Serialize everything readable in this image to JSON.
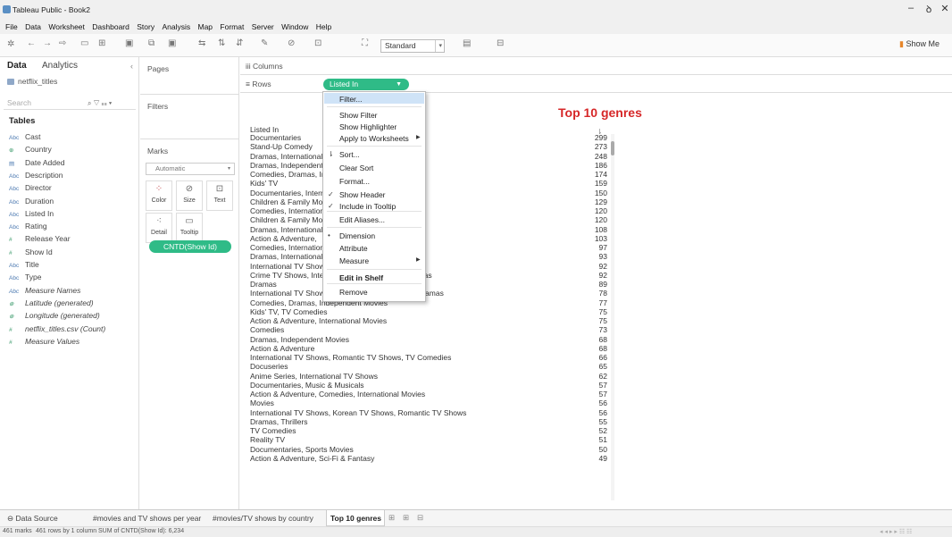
{
  "window": {
    "title": "Tableau Public - Book2",
    "controls": [
      "–",
      "ꝺ",
      "✕"
    ]
  },
  "menubar": [
    "File",
    "Data",
    "Worksheet",
    "Dashboard",
    "Story",
    "Analysis",
    "Map",
    "Format",
    "Server",
    "Window",
    "Help"
  ],
  "toolbar": {
    "fit_select": "Standard",
    "show_me": "Show Me"
  },
  "sidebar": {
    "tab_data": "Data",
    "tab_analytics": "Analytics",
    "datasource": "netflix_titles",
    "search_placeholder": "Search",
    "tables_header": "Tables",
    "fields": [
      {
        "icon": "Abc",
        "name": "Cast"
      },
      {
        "icon": "⊕",
        "name": "Country"
      },
      {
        "icon": "▤",
        "name": "Date Added"
      },
      {
        "icon": "Abc",
        "name": "Description"
      },
      {
        "icon": "Abc",
        "name": "Director"
      },
      {
        "icon": "Abc",
        "name": "Duration"
      },
      {
        "icon": "Abc",
        "name": "Listed In"
      },
      {
        "icon": "Abc",
        "name": "Rating"
      },
      {
        "icon": "#",
        "name": "Release Year"
      },
      {
        "icon": "#",
        "name": "Show Id"
      },
      {
        "icon": "Abc",
        "name": "Title"
      },
      {
        "icon": "Abc",
        "name": "Type"
      },
      {
        "icon": "Abc",
        "name": "Measure Names"
      },
      {
        "icon": "⊕",
        "name": "Latitude (generated)"
      },
      {
        "icon": "⊕",
        "name": "Longitude (generated)"
      },
      {
        "icon": "#",
        "name": "netflix_titles.csv (Count)"
      },
      {
        "icon": "#",
        "name": "Measure Values"
      }
    ]
  },
  "panes": {
    "pages": "Pages",
    "filters": "Filters",
    "marks": "Marks",
    "mark_type": "Automatic",
    "mark_buttons": [
      "Color",
      "Size",
      "Text",
      "Detail",
      "Tooltip"
    ],
    "marks_pill": "CNTD(Show Id)"
  },
  "shelves": {
    "columns": "Columns",
    "rows": "Rows",
    "row_pill": "Listed In"
  },
  "view": {
    "title": "Top 10 genres",
    "column_header": "Listed In"
  },
  "rows": [
    {
      "label": "Documentaries",
      "value": "299"
    },
    {
      "label": "Stand-Up Comedy",
      "value": "273"
    },
    {
      "label": "Dramas, International Movies",
      "value": "248"
    },
    {
      "label": "Dramas, Independent Movies, International Movies",
      "value": "186"
    },
    {
      "label": "Comedies, Dramas, International Movies",
      "value": "174"
    },
    {
      "label": "Kids' TV",
      "value": "159"
    },
    {
      "label": "Documentaries, International Movies",
      "value": "150"
    },
    {
      "label": "Children & Family Movies, Comedies",
      "value": "129"
    },
    {
      "label": "Comedies, International Movies",
      "value": "120"
    },
    {
      "label": "Children & Family Movies",
      "value": "120"
    },
    {
      "label": "Dramas, International Movies, Romantic Movies",
      "value": "108"
    },
    {
      "label": "Action & Adventure, ",
      "value": "103"
    },
    {
      "label": "Comedies, International Movies, Romantic Movies",
      "value": "97"
    },
    {
      "label": "Dramas, International Movies, Thrillers",
      "value": "93"
    },
    {
      "label": "International TV Shows, TV Dramas",
      "value": "92"
    },
    {
      "label": "Crime TV Shows, International TV Shows, TV Dramas",
      "value": "92"
    },
    {
      "label": "Dramas",
      "value": "89"
    },
    {
      "label": "International TV Shows, Romantic TV Shows, TV Dramas",
      "value": "78"
    },
    {
      "label": "Comedies, Dramas, Independent Movies",
      "value": "77"
    },
    {
      "label": "Kids' TV, TV Comedies",
      "value": "75"
    },
    {
      "label": "Action & Adventure, International Movies",
      "value": "75"
    },
    {
      "label": "Comedies",
      "value": "73"
    },
    {
      "label": "Dramas, Independent Movies",
      "value": "68"
    },
    {
      "label": "Action & Adventure",
      "value": "68"
    },
    {
      "label": "International TV Shows, Romantic TV Shows, TV Comedies",
      "value": "66"
    },
    {
      "label": "Docuseries",
      "value": "65"
    },
    {
      "label": "Anime Series, International TV Shows",
      "value": "62"
    },
    {
      "label": "Documentaries, Music & Musicals",
      "value": "57"
    },
    {
      "label": "Action & Adventure, Comedies, International Movies",
      "value": "57"
    },
    {
      "label": "Movies",
      "value": "56"
    },
    {
      "label": "International TV Shows, Korean TV Shows, Romantic TV Shows",
      "value": "56"
    },
    {
      "label": "Dramas, Thrillers",
      "value": "55"
    },
    {
      "label": "TV Comedies",
      "value": "52"
    },
    {
      "label": "Reality TV",
      "value": "51"
    },
    {
      "label": "Documentaries, Sports Movies",
      "value": "50"
    },
    {
      "label": "Action & Adventure, Sci-Fi & Fantasy",
      "value": "49"
    }
  ],
  "context_menu": {
    "items": [
      {
        "label": "Filter...",
        "highlighted": true
      },
      {
        "label": "Show Filter"
      },
      {
        "label": "Show Highlighter"
      },
      {
        "label": "Apply to Worksheets",
        "submenu": true
      },
      {
        "label": "Sort..."
      },
      {
        "label": "Clear Sort"
      },
      {
        "label": "Format..."
      },
      {
        "label": "Show Header",
        "checked": true
      },
      {
        "label": "Include in Tooltip",
        "checked": true
      },
      {
        "label": "Edit Aliases..."
      },
      {
        "label": "Dimension",
        "bullet": true
      },
      {
        "label": "Attribute"
      },
      {
        "label": "Measure",
        "submenu": true
      },
      {
        "label": "Edit in Shelf",
        "bold": true
      },
      {
        "label": "Remove"
      }
    ]
  },
  "sheet_tabs": {
    "data_source": "Data Source",
    "tabs": [
      "#movies and TV shows per year",
      "#movies/TV shows by country",
      "Top 10 genres"
    ]
  },
  "status": {
    "marks": "461 marks",
    "rows": "461 rows by 1 column",
    "sum": "SUM of CNTD(Show Id): 6,234"
  }
}
